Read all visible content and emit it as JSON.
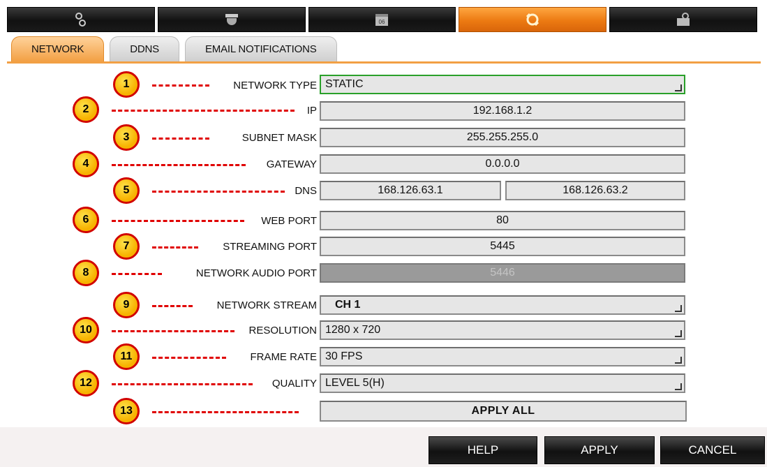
{
  "top_menu": [
    {
      "icon": "network-nodes-icon"
    },
    {
      "icon": "camera-dome-icon"
    },
    {
      "icon": "calendar-icon"
    },
    {
      "icon": "network-settings-icon",
      "active": true
    },
    {
      "icon": "system-tools-icon"
    }
  ],
  "calendar_day": "06",
  "tabs": [
    {
      "label": "NETWORK",
      "active": true
    },
    {
      "label": "DDNS",
      "active": false
    },
    {
      "label": "EMAIL NOTIFICATIONS",
      "active": false
    }
  ],
  "badges": [
    "1",
    "2",
    "3",
    "4",
    "5",
    "6",
    "7",
    "8",
    "9",
    "10",
    "11",
    "12",
    "13"
  ],
  "fields": {
    "network_type": {
      "label": "NETWORK TYPE",
      "value": "STATIC"
    },
    "ip": {
      "label": "IP",
      "value": "192.168.1.2"
    },
    "subnet_mask": {
      "label": "SUBNET MASK",
      "value": "255.255.255.0"
    },
    "gateway": {
      "label": "GATEWAY",
      "value": "0.0.0.0"
    },
    "dns": {
      "label": "DNS",
      "value1": "168.126.63.1",
      "value2": "168.126.63.2"
    },
    "web_port": {
      "label": "WEB PORT",
      "value": "80"
    },
    "streaming_port": {
      "label": "STREAMING PORT",
      "value": "5445"
    },
    "network_audio_port": {
      "label": "NETWORK AUDIO PORT",
      "value": "5446"
    },
    "network_stream": {
      "label": "NETWORK STREAM",
      "value": "CH 1"
    },
    "resolution": {
      "label": "RESOLUTION",
      "value": "1280 x 720"
    },
    "frame_rate": {
      "label": "FRAME RATE",
      "value": "30 FPS"
    },
    "quality": {
      "label": "QUALITY",
      "value": "LEVEL 5(H)"
    },
    "apply_all": {
      "label": "APPLY ALL"
    }
  },
  "buttons": {
    "help": "HELP",
    "apply": "APPLY",
    "cancel": "CANCEL"
  },
  "colors": {
    "accent": "#f2a044",
    "badge_fill": "#f7b200",
    "badge_border": "#d10000",
    "dash": "#e00000"
  }
}
